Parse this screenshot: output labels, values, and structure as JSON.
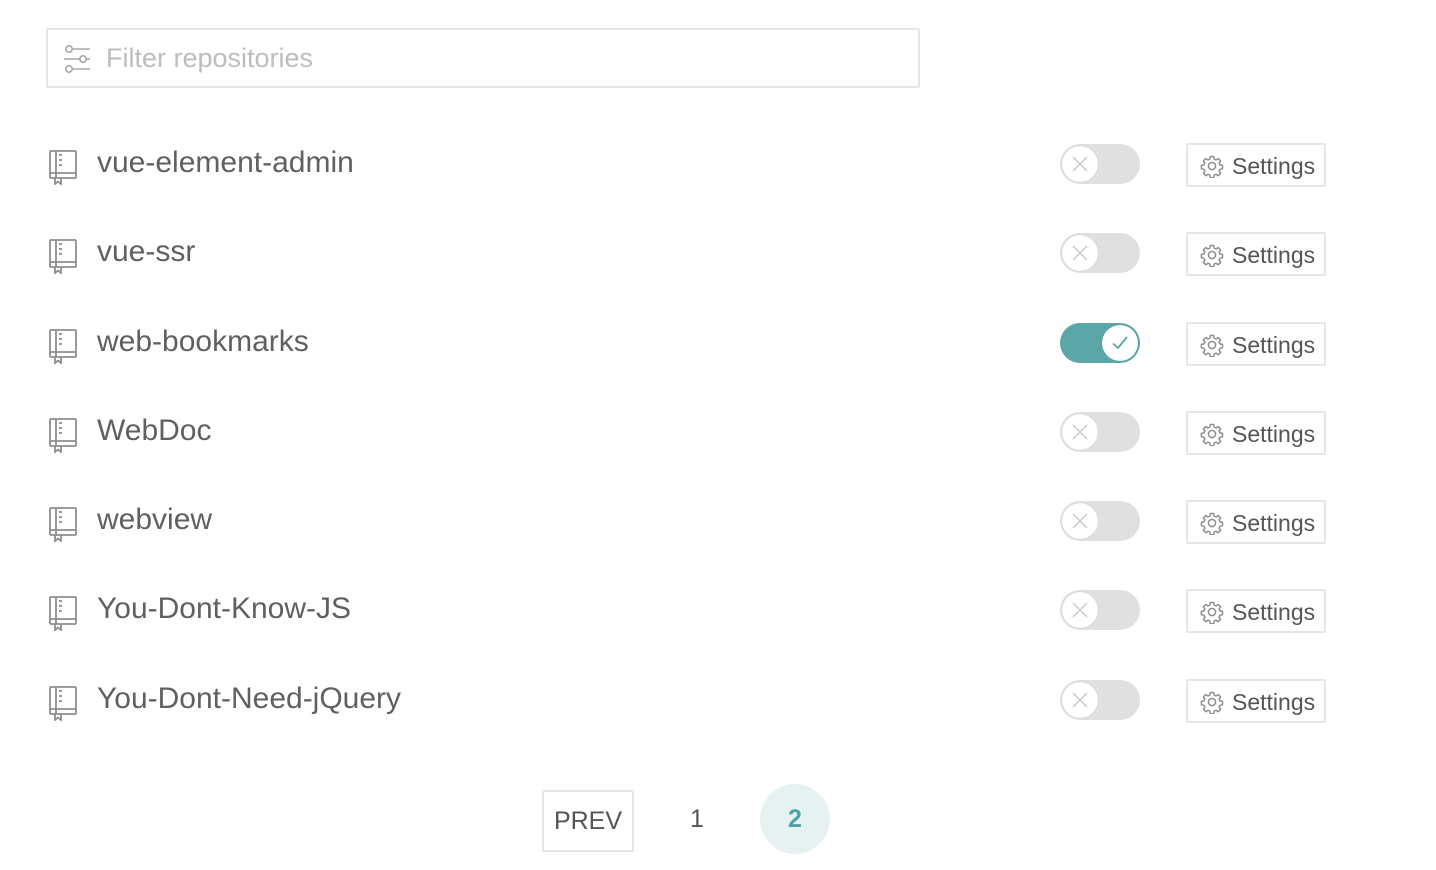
{
  "filter": {
    "placeholder": "Filter repositories",
    "value": ""
  },
  "repos": [
    {
      "name": "vue-element-admin",
      "enabled": false,
      "settings_label": "Settings"
    },
    {
      "name": "vue-ssr",
      "enabled": false,
      "settings_label": "Settings"
    },
    {
      "name": "web-bookmarks",
      "enabled": true,
      "settings_label": "Settings"
    },
    {
      "name": "WebDoc",
      "enabled": false,
      "settings_label": "Settings"
    },
    {
      "name": "webview",
      "enabled": false,
      "settings_label": "Settings"
    },
    {
      "name": "You-Dont-Know-JS",
      "enabled": false,
      "settings_label": "Settings"
    },
    {
      "name": "You-Dont-Need-jQuery",
      "enabled": false,
      "settings_label": "Settings"
    }
  ],
  "pagination": {
    "prev_label": "PREV",
    "pages": [
      "1",
      "2"
    ],
    "current": "2"
  },
  "icons": {
    "filter": "sliders-icon",
    "repo": "repo-book-icon",
    "settings": "gear-icon",
    "toggle_off": "close-icon",
    "toggle_on": "check-icon"
  },
  "colors": {
    "accent": "#5ba6a6",
    "toggle_off": "#e0e0e0",
    "current_page_bg": "#e6f1f2",
    "current_page_text": "#4fa1a8"
  }
}
